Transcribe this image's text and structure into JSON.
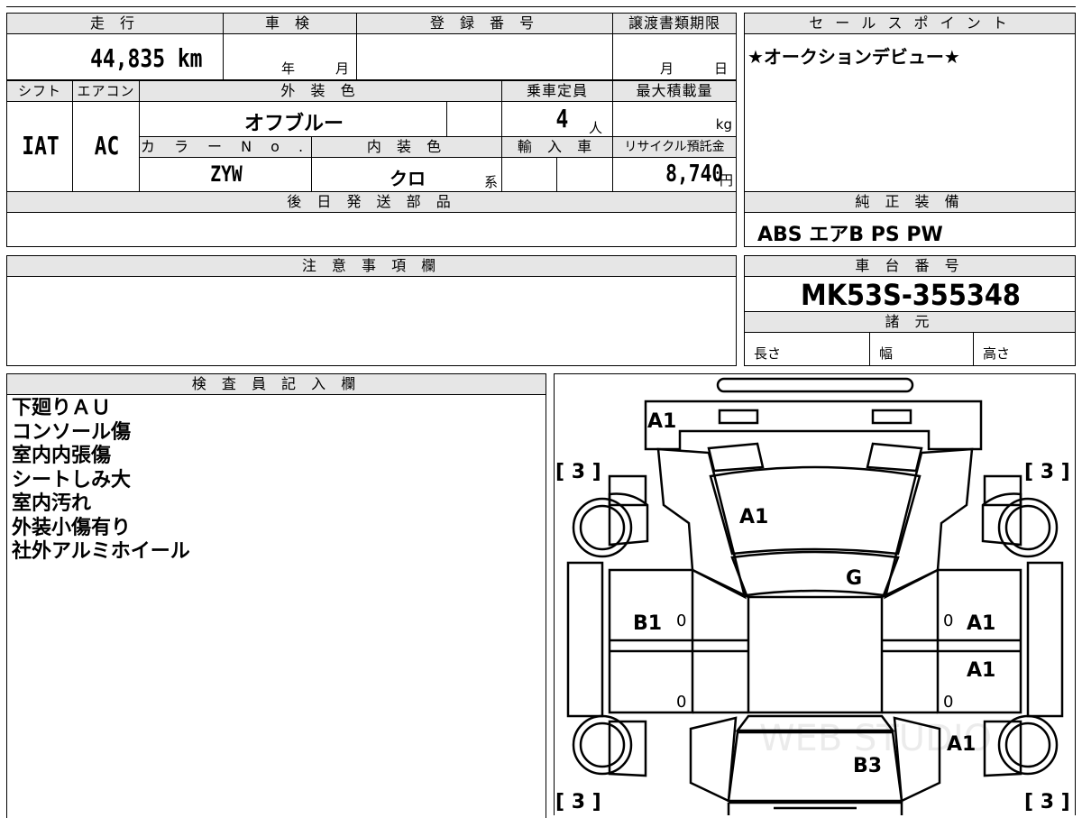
{
  "mileage": {
    "header": "走 行",
    "value": "44,835 km"
  },
  "inspection": {
    "header": "車 検",
    "year_unit": "年",
    "month_unit": "月"
  },
  "registration": {
    "header": "登 録 番 号",
    "value": ""
  },
  "transfer_deadline": {
    "header": "譲渡書類期限",
    "month_unit": "月",
    "day_unit": "日"
  },
  "sales_point": {
    "header": "セ ー ル ス ポ イ ン ト",
    "text": "★オークションデビュー★"
  },
  "shift": {
    "header": "シフト",
    "value": "IAT"
  },
  "aircon": {
    "header": "エアコン",
    "value": "AC"
  },
  "exterior_color": {
    "header": "外 装 色",
    "value": "オフブルー"
  },
  "capacity": {
    "header": "乗車定員",
    "value": "4",
    "unit": "人"
  },
  "max_load": {
    "header": "最大積載量",
    "unit": "kg"
  },
  "color_no": {
    "header": "カ ラ ー N o .",
    "value": "ZYW"
  },
  "interior_color": {
    "header": "内 装 色",
    "value": "クロ",
    "suffix": "系"
  },
  "import": {
    "header": "輸 入 車"
  },
  "recycle_fee": {
    "header": "リサイクル預託金",
    "value": "8,740",
    "unit": "円"
  },
  "later_parts": {
    "header": "後 日 発 送 部 品"
  },
  "genuine_equipment": {
    "header": "純 正 装 備",
    "value": "ABS エアB PS PW"
  },
  "caution": {
    "header": "注 意 事 項 欄"
  },
  "chassis_no": {
    "header": "車 台 番 号",
    "value": "MK53S-355348"
  },
  "specs": {
    "header": "諸 元",
    "length": "長さ",
    "width": "幅",
    "height": "高さ"
  },
  "inspector": {
    "header": "検 査 員 記 入 欄",
    "notes": [
      "下廻りＡＵ",
      "コンソール傷",
      "室内内張傷",
      "シートしみ大",
      "室内汚れ",
      "外装小傷有り",
      "社外アルミホイール"
    ]
  },
  "diagram": {
    "marks": [
      "A1",
      "A1",
      "G",
      "B1",
      "A1",
      "A1",
      "A1",
      "B3"
    ],
    "tread_marks": [
      "[ 3 ]",
      "[ 3 ]",
      "[ 3 ]",
      "[ 3 ]"
    ],
    "zero_marks": [
      "0",
      "0",
      "0",
      "0"
    ],
    "watermark": "WEB STUDIO"
  }
}
